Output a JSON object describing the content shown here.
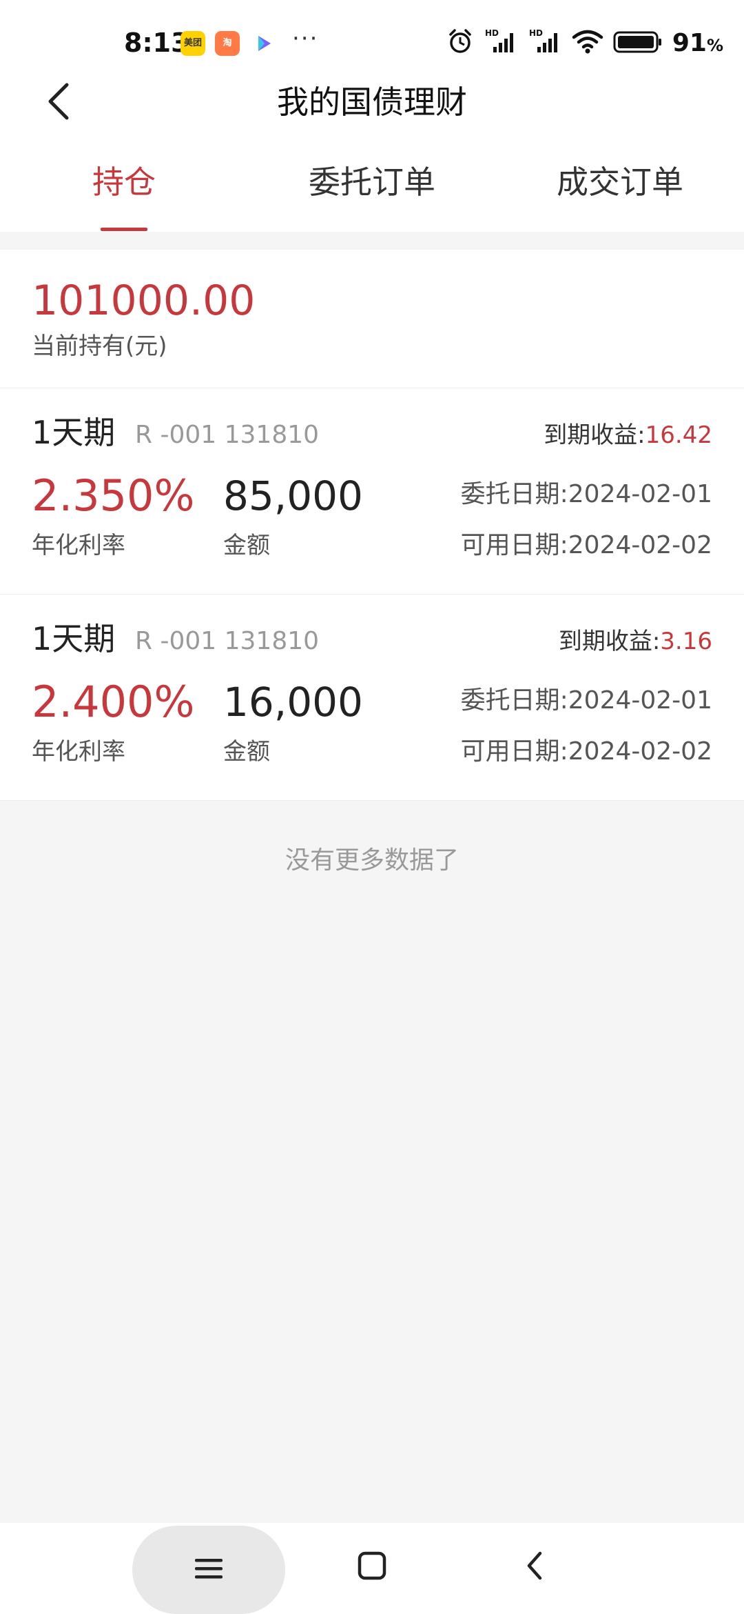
{
  "status_bar": {
    "time": "8:13",
    "app_badges": [
      "美团",
      "淘",
      "▶"
    ],
    "more": "···",
    "battery_percent": "91",
    "battery_unit": "%"
  },
  "header": {
    "title": "我的国债理财"
  },
  "tabs": [
    {
      "label": "持仓",
      "active": true
    },
    {
      "label": "委托订单",
      "active": false
    },
    {
      "label": "成交订单",
      "active": false
    }
  ],
  "summary": {
    "total": "101000.00",
    "label": "当前持有(元)"
  },
  "holdings": [
    {
      "term": "1天期",
      "code": "R -001 131810",
      "yield_label": "到期收益:",
      "yield_value": "16.42",
      "rate": "2.350%",
      "rate_label": "年化利率",
      "amount": "85,000",
      "amount_label": "金额",
      "entrust_date": "委托日期:2024-02-01",
      "available_date": "可用日期:2024-02-02"
    },
    {
      "term": "1天期",
      "code": "R -001 131810",
      "yield_label": "到期收益:",
      "yield_value": "3.16",
      "rate": "2.400%",
      "rate_label": "年化利率",
      "amount": "16,000",
      "amount_label": "金额",
      "entrust_date": "委托日期:2024-02-01",
      "available_date": "可用日期:2024-02-02"
    }
  ],
  "footer_text": "没有更多数据了",
  "colors": {
    "accent": "#c8373c",
    "background": "#f5f5f5"
  }
}
